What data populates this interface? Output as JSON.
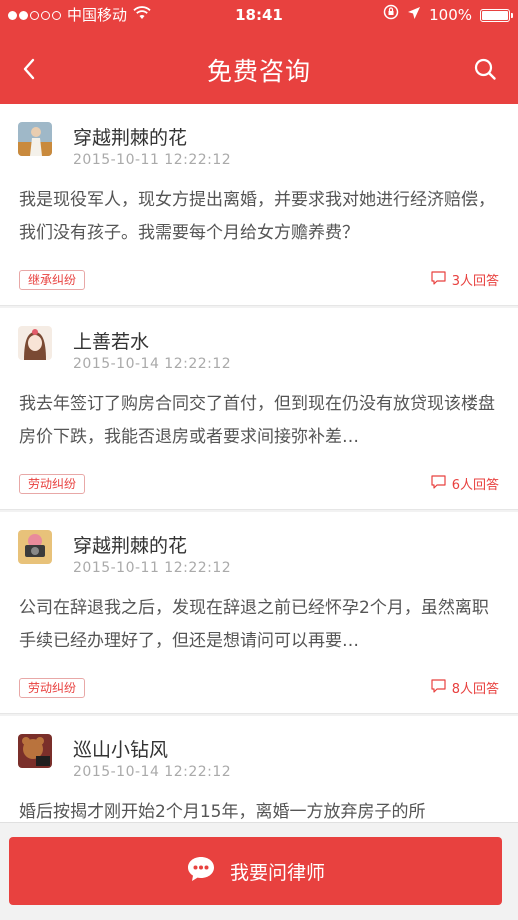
{
  "status_bar": {
    "carrier": "中国移动",
    "time": "18:41",
    "battery": "100%"
  },
  "nav": {
    "title": "免费咨询"
  },
  "questions": [
    {
      "username": "穿越荆棘的花",
      "time": "2015-10-11 12:22:12",
      "text": "我是现役军人，现女方提出离婚，并要求我对她进行经济赔偿，我们没有孩子。我需要每个月给女方赡养费？",
      "tag": "继承纠纷",
      "answers": "3人回答"
    },
    {
      "username": "上善若水",
      "time": "2015-10-14 12:22:12",
      "text": "我去年签订了购房合同交了首付，但到现在仍没有放贷现该楼盘房价下跌，我能否退房或者要求间接弥补差…",
      "tag": "劳动纠纷",
      "answers": "6人回答"
    },
    {
      "username": "穿越荆棘的花",
      "time": "2015-10-11 12:22:12",
      "text": "公司在辞退我之后，发现在辞退之前已经怀孕2个月，虽然离职手续已经办理好了，但还是想请问可以再要…",
      "tag": "劳动纠纷",
      "answers": "8人回答"
    },
    {
      "username": "巡山小钻风",
      "time": "2015-10-14 12:22:12",
      "text": "婚后按揭才刚开始2个月15年，离婚一方放弃房子的所"
    }
  ],
  "bottom": {
    "ask_label": "我要问律师"
  },
  "icons": {
    "back": "chevron-left-icon",
    "search": "search-icon",
    "comment": "comment-icon",
    "chat": "chat-bubble-icon"
  },
  "colors": {
    "brand": "#e8413f",
    "tag_border": "#e8a8a7"
  }
}
